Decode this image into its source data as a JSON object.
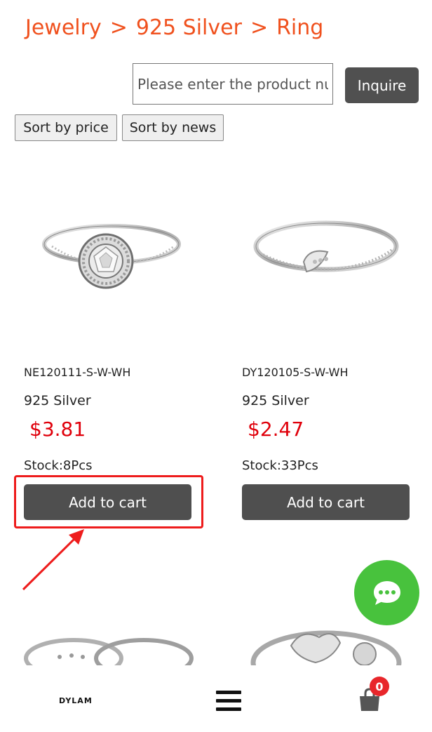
{
  "breadcrumb": {
    "items": [
      "Jewelry",
      "925 Silver",
      "Ring"
    ],
    "separator": ">"
  },
  "search": {
    "placeholder": "Please enter the product number",
    "button_label": "Inquire"
  },
  "sort": {
    "price_label": "Sort by price",
    "news_label": "Sort by news"
  },
  "products": [
    {
      "sku": "NE120111-S-W-WH",
      "material": "925 Silver",
      "price": "$3.81",
      "stock": "Stock:8Pcs",
      "cart_label": "Add to cart"
    },
    {
      "sku": "DY120105-S-W-WH",
      "material": "925 Silver",
      "price": "$2.47",
      "stock": "Stock:33Pcs",
      "cart_label": "Add to cart"
    }
  ],
  "bottom_nav": {
    "logo_text": "DYLAM",
    "cart_count": "0"
  },
  "colors": {
    "breadcrumb": "#f0511e",
    "price": "#e0000b",
    "button": "#505050",
    "chat": "#48c23d",
    "annotation": "#ee1c1c"
  }
}
